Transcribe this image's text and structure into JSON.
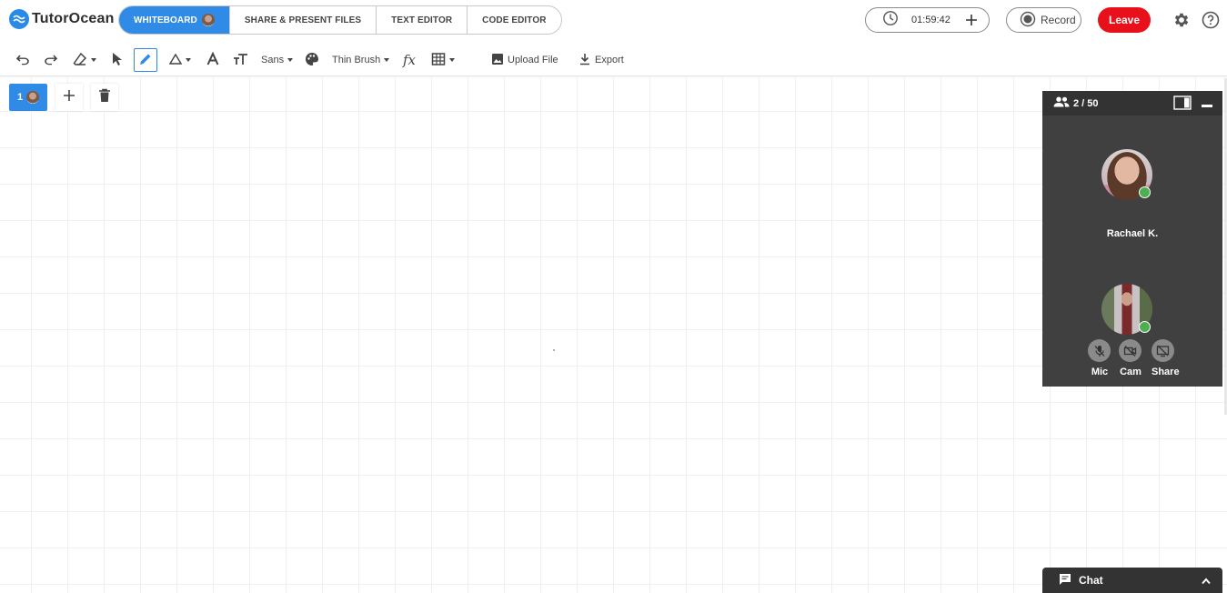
{
  "header": {
    "brand": "TutorOcean",
    "tabs": [
      {
        "label": "WHITEBOARD",
        "active": true
      },
      {
        "label": "SHARE & PRESENT FILES",
        "active": false
      },
      {
        "label": "TEXT EDITOR",
        "active": false
      },
      {
        "label": "CODE EDITOR",
        "active": false
      }
    ],
    "timer": "01:59:42",
    "record_label": "Record",
    "leave_label": "Leave",
    "accent_color": "#2f8be6",
    "leave_color": "#e8101a"
  },
  "toolbar": {
    "font_label": "Sans",
    "brush_label": "Thin Brush",
    "formula_label": "fx",
    "upload_label": "Upload File",
    "export_label": "Export",
    "active_tool": "pencil"
  },
  "pages": {
    "current": "1"
  },
  "participants": {
    "count": "2 / 50",
    "people": [
      {
        "name": "Rachael K.",
        "online": true
      },
      {
        "name": "",
        "online": true
      }
    ],
    "controls": [
      {
        "label": "Mic",
        "icon": "mic-off-icon"
      },
      {
        "label": "Cam",
        "icon": "cam-off-icon"
      },
      {
        "label": "Share",
        "icon": "screen-share-off-icon"
      }
    ]
  },
  "chat": {
    "label": "Chat"
  }
}
